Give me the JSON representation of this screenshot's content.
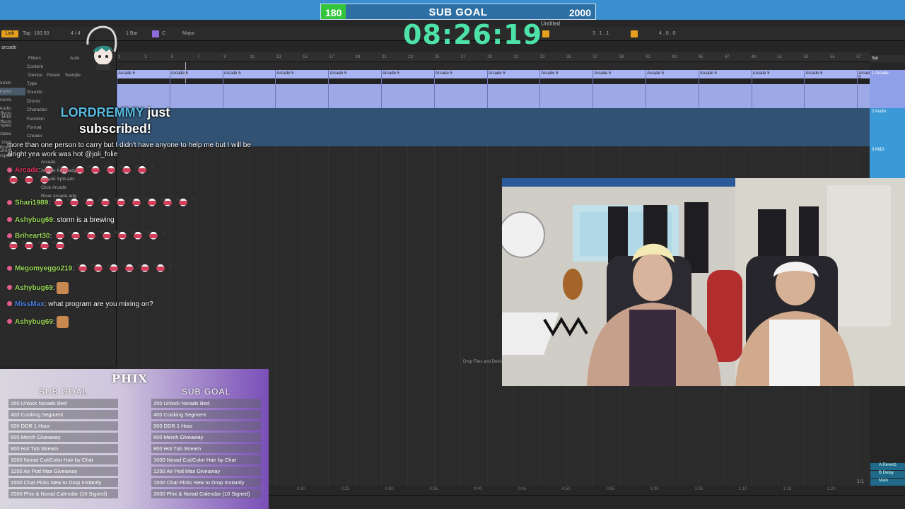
{
  "subgoal": {
    "current": "180",
    "title": "SUB GOAL",
    "target": "2000",
    "progress_fraction": 0.09
  },
  "timer": "08:26:19",
  "daw": {
    "link_label": "Link",
    "tap_label": "Tap",
    "tempo": "160.00",
    "signature": "4 / 4",
    "quantize": "1 Bar",
    "key_root": "C",
    "scale": "Major",
    "project_title": "Untitled",
    "position": "3 . 1 . 1",
    "loop_length": "4 . 0 . 0",
    "browser": {
      "search": "arcade",
      "filters_label": "Filters",
      "auto_label": "Auto",
      "content_label": "Content",
      "tabs": [
        "Device",
        "Preset",
        "Sample"
      ],
      "filter_items": [
        "Type",
        "Sounds",
        "Drums",
        "Character",
        "Function",
        "Format",
        "Creator"
      ],
      "side_items": [
        "Sounds",
        "Drums",
        "Instruments",
        "Audio Effects",
        "MIDI Effects",
        "Samples",
        "Templates",
        "User Library",
        "Current Project"
      ],
      "results": [
        "Arcade",
        "Arcade Keys.adg",
        "Arcade Split.adv",
        "Click Arcade",
        "Riser Arcade.adg"
      ]
    },
    "ruler_marks": [
      "1",
      "3",
      "5",
      "7",
      "9",
      "11",
      "13",
      "15",
      "17",
      "19",
      "21",
      "23",
      "25",
      "27",
      "29",
      "31",
      "33",
      "35",
      "37",
      "39",
      "41",
      "43",
      "45",
      "47",
      "49",
      "51",
      "53",
      "55",
      "57"
    ],
    "clip_name": "Arcade 5",
    "set_label": "Set",
    "tracks": [
      {
        "label": "1 Arcade",
        "color": "#8fa0e8"
      },
      {
        "label": "2 Audio",
        "color": "#3a9ad8"
      },
      {
        "label": "3 MIDI",
        "color": "#3a9ad8"
      }
    ],
    "returns": [
      "A Reverb",
      "B Delay",
      "Main"
    ],
    "drop_hint": "Drop Files and Devices Here",
    "time_marks": [
      "0:20",
      "0:25",
      "0:30",
      "0:35",
      "0:40",
      "0:45",
      "0:50",
      "0:55",
      "1:00",
      "1:05",
      "1:10",
      "1:15",
      "1:20"
    ],
    "pager": "1/1"
  },
  "alert": {
    "name": "LORDREMMY",
    "action": "just subscribed!"
  },
  "chat": {
    "partial_line": "more than one person to carry but I didn't have anyone to help me but I will be alright yea work was hot @joli_folie",
    "messages": [
      {
        "user": "Arcade",
        "user_color": "#e0305a",
        "text": "",
        "emotes": 10,
        "emote_wrap": 3
      },
      {
        "user": "Shari1989",
        "user_color": "#9ad65a",
        "text": "",
        "emotes": 9
      },
      {
        "user": "Ashybug69",
        "user_color": "#9ad65a",
        "text": "storm is a brewing",
        "emotes": 0
      },
      {
        "user": "Briheart30",
        "user_color": "#9ad65a",
        "text": "",
        "emotes": 11,
        "emote_wrap": 4
      },
      {
        "user": "Megomyeggo219",
        "user_color": "#9ad65a",
        "text": "",
        "emotes": 6
      },
      {
        "user": "Ashybug69",
        "user_color": "#9ad65a",
        "text": "",
        "emotes": 1,
        "emote_type": "small"
      },
      {
        "user": "MissMax",
        "user_color": "#4a7fe0",
        "text": "what program are you mixing on?",
        "emotes": 0
      },
      {
        "user": "Ashybug69",
        "user_color": "#9ad65a",
        "text": "",
        "emotes": 1,
        "emote_type": "small"
      }
    ]
  },
  "goals": {
    "logo": "PHIX",
    "heading": "SUB GOAL",
    "left": [
      "250 Unlock Norads Bed",
      "400 Cooking Segment",
      "500 DDR 1 Hour",
      "600 Merch Giveaway",
      "800 Hot Tub Stream",
      "1000 Norad Cut/Color Hair by Chat",
      "1250 Air Pod Max Giveaway",
      "1500 Chat Picks New to Drop Instantly",
      "2000 Phix & Norad Calendar (10 Signed)"
    ],
    "right": [
      "250 Unlock Norads Bed",
      "400 Cooking Segment",
      "500 DDR 1 Hour",
      "600 Merch Giveaway",
      "800 Hot Tub Stream",
      "1000 Norad Cut/Color Hair by Chat",
      "1250 Air Pod Max Giveaway",
      "1500 Chat Picks New to Drop Instantly",
      "2000 Phix & Norad Calendar (10 Signed)"
    ]
  },
  "colors": {
    "accent_green": "#4de3a8",
    "bar_blue": "#2e6fa3",
    "clip_purple": "#a9b4f2"
  }
}
